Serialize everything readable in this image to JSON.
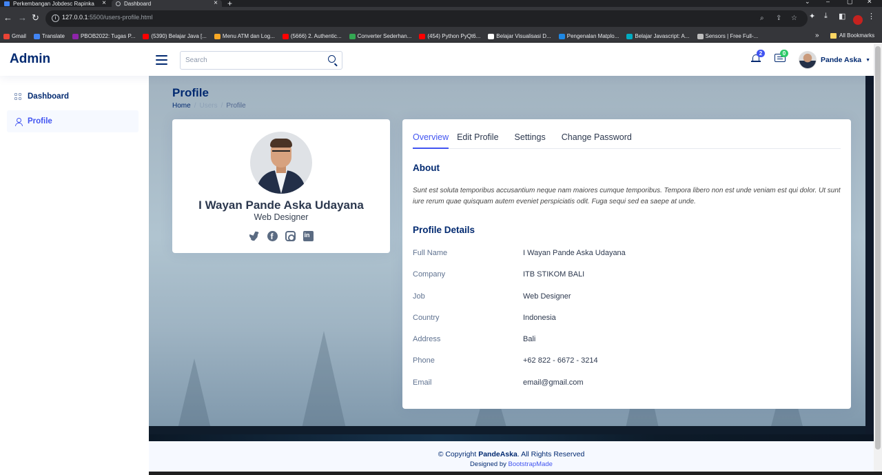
{
  "browser": {
    "tabs": [
      {
        "title": "Perkembangan Jobdesc Rapinka",
        "active": false
      },
      {
        "title": "Dashboard",
        "active": true
      }
    ],
    "url_host": "127.0.0.1",
    "url_path": ":5500/users-profile.html",
    "bookmarks": [
      {
        "label": "Gmail",
        "color": "#ea4335"
      },
      {
        "label": "Translate",
        "color": "#4285f4"
      },
      {
        "label": "PBOB2022: Tugas P...",
        "color": "#8e24aa"
      },
      {
        "label": "(5390) Belajar Java [...",
        "color": "#ff0000"
      },
      {
        "label": "Menu ATM dan Log...",
        "color": "#f9a825"
      },
      {
        "label": "(5666) 2. Authentic...",
        "color": "#ff0000"
      },
      {
        "label": "Converter Sederhan...",
        "color": "#34a853"
      },
      {
        "label": "(454) Python PyQt6...",
        "color": "#ff0000"
      },
      {
        "label": "Belajar Visualisasi D...",
        "color": "#ffffff"
      },
      {
        "label": "Pengenalan Matplo...",
        "color": "#1e88e5"
      },
      {
        "label": "Belajar Javascript: A...",
        "color": "#00acc1"
      },
      {
        "label": "Sensors | Free Full-...",
        "color": "#bdbdbd"
      }
    ],
    "all_bookmarks": "All Bookmarks"
  },
  "header": {
    "logo": "Admin",
    "search_placeholder": "Search",
    "notifications_count": "2",
    "messages_count": "0",
    "user_name": "Pande Aska"
  },
  "sidebar": {
    "items": [
      {
        "label": "Dashboard",
        "active": false
      },
      {
        "label": "Profile",
        "active": true
      }
    ]
  },
  "page": {
    "title": "Profile",
    "breadcrumb": [
      "Home",
      "Users",
      "Profile"
    ]
  },
  "profile_card": {
    "name": "I Wayan Pande Aska Udayana",
    "role": "Web Designer",
    "socials": [
      "twitter-icon",
      "facebook-icon",
      "instagram-icon",
      "linkedin-icon"
    ]
  },
  "tabs": [
    "Overview",
    "Edit Profile",
    "Settings",
    "Change Password"
  ],
  "about": {
    "title": "About",
    "text": "Sunt est soluta temporibus accusantium neque nam maiores cumque temporibus. Tempora libero non est unde veniam est qui dolor. Ut sunt iure rerum quae quisquam autem eveniet perspiciatis odit. Fuga sequi sed ea saepe at unde."
  },
  "details": {
    "title": "Profile Details",
    "rows": [
      {
        "label": "Full Name",
        "value": "I Wayan Pande Aska Udayana"
      },
      {
        "label": "Company",
        "value": "ITB STIKOM BALI"
      },
      {
        "label": "Job",
        "value": "Web Designer"
      },
      {
        "label": "Country",
        "value": "Indonesia"
      },
      {
        "label": "Address",
        "value": "Bali"
      },
      {
        "label": "Phone",
        "value": "+62 822 - 6672 - 3214"
      },
      {
        "label": "Email",
        "value": "email@gmail.com"
      }
    ]
  },
  "footer": {
    "copyright_prefix": "© Copyright",
    "brand": "PandeAska",
    "rights": ". All Rights Reserved",
    "designed_by": "Designed by",
    "designer": "BootstrapMade"
  },
  "colors": {
    "primary": "#4154f1",
    "navy": "#012970",
    "badge_green": "#2eca6a"
  }
}
